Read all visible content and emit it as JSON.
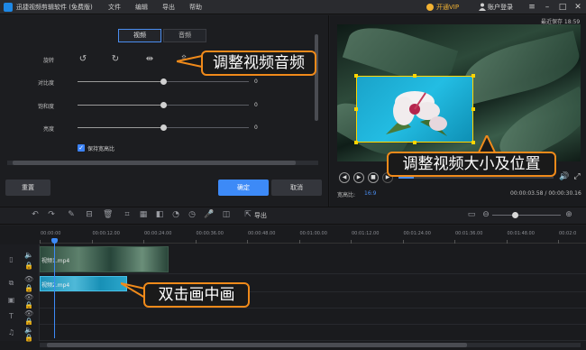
{
  "titlebar": {
    "app_title": "迅捷视频剪辑软件 (免费版)",
    "menus": [
      "文件",
      "编辑",
      "导出",
      "帮助"
    ],
    "vip": "开通VIP",
    "login": "账户登录"
  },
  "autosave": "最近保存 18:59",
  "left_panel": {
    "tabs": [
      "视频",
      "音频"
    ],
    "rotate_label": "旋转",
    "contrast_label": "对比度",
    "contrast_value": "0",
    "saturation_label": "饱和度",
    "saturation_value": "0",
    "brightness_label": "亮度",
    "brightness_value": "0",
    "slider_levels": {
      "contrast": 0.5,
      "saturation": 0.5,
      "brightness": 0.5
    },
    "keep_ratio": "保持宽高比",
    "reset": "重置",
    "ok": "确定",
    "cancel": "取消"
  },
  "preview": {
    "aspect_label": "宽高比:",
    "aspect_value": "16:9",
    "time": "00:00:03.58 / 00:00:30.16",
    "progress": 0.1
  },
  "toolbar": {
    "export": "导出"
  },
  "timeline": {
    "ticks": [
      "00:00:00",
      "00:00:12.00",
      "00:00:24.00",
      "00:00:36.00",
      "00:00:48.00",
      "00:01:00.00",
      "00:01:12.00",
      "00:01:24.00",
      "00:01:36.00",
      "00:01:48.00",
      "00:02:0"
    ],
    "clip_main": "视频1.mp4",
    "clip_pip": "视频2.mp4"
  },
  "callouts": {
    "audio": "调整视频音频",
    "size": "调整视频大小及位置",
    "pip": "双击画中画"
  },
  "colors": {
    "accent": "#3d8af7",
    "callout_border": "#f08a1a",
    "vip": "#f2b233",
    "pip_border": "#ffd400"
  }
}
